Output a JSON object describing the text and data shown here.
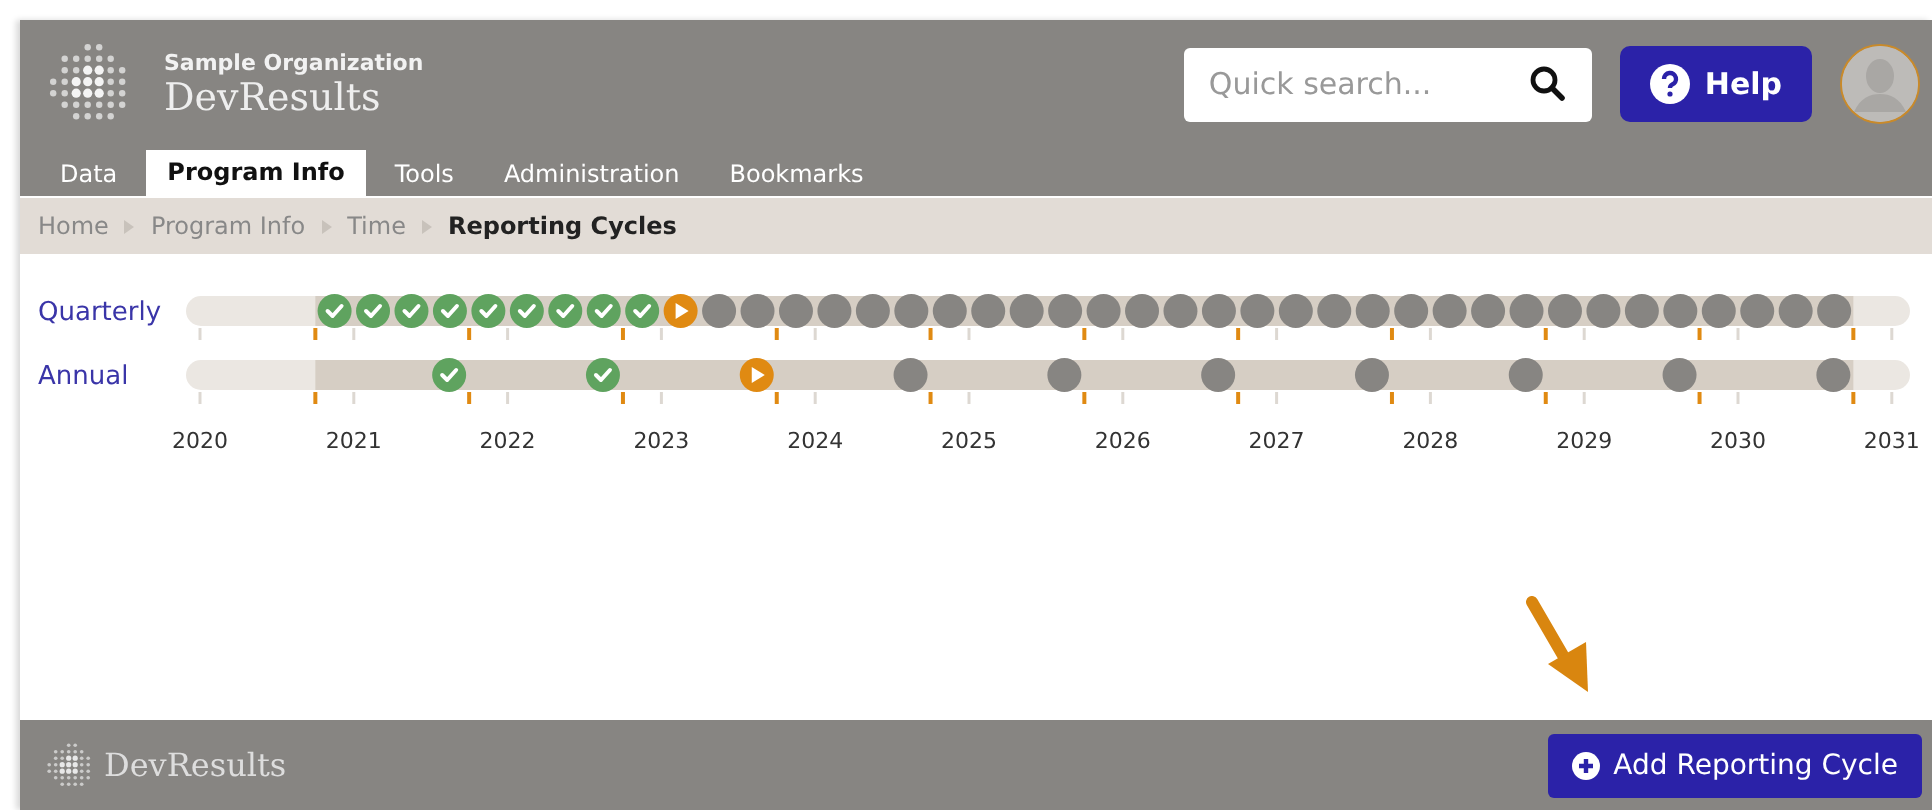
{
  "header": {
    "organization": "Sample Organization",
    "product": "DevResults",
    "search": {
      "placeholder": "Quick search..."
    },
    "help_button": "Help"
  },
  "tabs": [
    {
      "label": "Data",
      "selected": false
    },
    {
      "label": "Program Info",
      "selected": true
    },
    {
      "label": "Tools",
      "selected": false
    },
    {
      "label": "Administration",
      "selected": false
    },
    {
      "label": "Bookmarks",
      "selected": false
    }
  ],
  "breadcrumb": [
    {
      "label": "Home",
      "current": false
    },
    {
      "label": "Program Info",
      "current": false
    },
    {
      "label": "Time",
      "current": false
    },
    {
      "label": "Reporting Cycles",
      "current": true
    }
  ],
  "timeline": {
    "rows": [
      {
        "label": "Quarterly",
        "kind": "quarterly",
        "periods": [
          {
            "kind": "done"
          },
          {
            "kind": "done"
          },
          {
            "kind": "done"
          },
          {
            "kind": "done"
          },
          {
            "kind": "done"
          },
          {
            "kind": "done"
          },
          {
            "kind": "done"
          },
          {
            "kind": "done"
          },
          {
            "kind": "done"
          },
          {
            "kind": "current"
          },
          {
            "kind": "upcoming"
          },
          {
            "kind": "upcoming"
          },
          {
            "kind": "upcoming"
          },
          {
            "kind": "upcoming"
          },
          {
            "kind": "upcoming"
          },
          {
            "kind": "upcoming"
          },
          {
            "kind": "upcoming"
          },
          {
            "kind": "upcoming"
          },
          {
            "kind": "upcoming"
          },
          {
            "kind": "upcoming"
          },
          {
            "kind": "upcoming"
          },
          {
            "kind": "upcoming"
          },
          {
            "kind": "upcoming"
          },
          {
            "kind": "upcoming"
          },
          {
            "kind": "upcoming"
          },
          {
            "kind": "upcoming"
          },
          {
            "kind": "upcoming"
          },
          {
            "kind": "upcoming"
          },
          {
            "kind": "upcoming"
          },
          {
            "kind": "upcoming"
          },
          {
            "kind": "upcoming"
          },
          {
            "kind": "upcoming"
          },
          {
            "kind": "upcoming"
          },
          {
            "kind": "upcoming"
          },
          {
            "kind": "upcoming"
          },
          {
            "kind": "upcoming"
          },
          {
            "kind": "upcoming"
          },
          {
            "kind": "upcoming"
          },
          {
            "kind": "upcoming"
          },
          {
            "kind": "upcoming"
          }
        ]
      },
      {
        "label": "Annual",
        "kind": "annual",
        "periods": [
          {
            "kind": "done"
          },
          {
            "kind": "done"
          },
          {
            "kind": "current"
          },
          {
            "kind": "upcoming"
          },
          {
            "kind": "upcoming"
          },
          {
            "kind": "upcoming"
          },
          {
            "kind": "upcoming"
          },
          {
            "kind": "upcoming"
          },
          {
            "kind": "upcoming"
          },
          {
            "kind": "upcoming"
          }
        ]
      }
    ],
    "years": [
      "2020",
      "2021",
      "2022",
      "2023",
      "2024",
      "2025",
      "2026",
      "2027",
      "2028",
      "2029",
      "2030",
      "2031"
    ]
  },
  "footer": {
    "product": "DevResults",
    "add_button": "Add Reporting Cycle"
  }
}
